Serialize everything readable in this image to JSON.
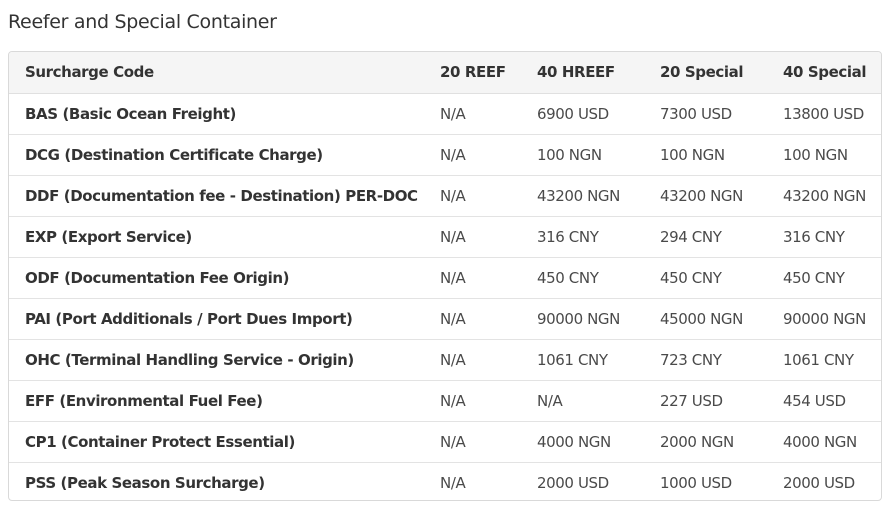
{
  "section": {
    "title": "Reefer and Special Container"
  },
  "table": {
    "headers": [
      "Surcharge Code",
      "20 REEF",
      "40 HREEF",
      "20 Special",
      "40 Special"
    ],
    "rows": [
      [
        "BAS (Basic Ocean Freight)",
        "N/A",
        "6900 USD",
        "7300 USD",
        "13800 USD"
      ],
      [
        "DCG (Destination Certificate Charge)",
        "N/A",
        "100 NGN",
        "100 NGN",
        "100 NGN"
      ],
      [
        "DDF (Documentation fee - Destination) PER-DOC",
        "N/A",
        "43200 NGN",
        "43200 NGN",
        "43200 NGN"
      ],
      [
        "EXP (Export Service)",
        "N/A",
        "316 CNY",
        "294 CNY",
        "316 CNY"
      ],
      [
        "ODF (Documentation Fee Origin)",
        "N/A",
        "450 CNY",
        "450 CNY",
        "450 CNY"
      ],
      [
        "PAI (Port Additionals / Port Dues Import)",
        "N/A",
        "90000 NGN",
        "45000 NGN",
        "90000 NGN"
      ],
      [
        "OHC (Terminal Handling Service - Origin)",
        "N/A",
        "1061 CNY",
        "723 CNY",
        "1061 CNY"
      ],
      [
        "EFF (Environmental Fuel Fee)",
        "N/A",
        "N/A",
        "227 USD",
        "454 USD"
      ],
      [
        "CP1 (Container Protect Essential)",
        "N/A",
        "4000 NGN",
        "2000 NGN",
        "4000 NGN"
      ],
      [
        "PSS (Peak Season Surcharge)",
        "N/A",
        "2000 USD",
        "1000 USD",
        "2000 USD"
      ]
    ]
  }
}
